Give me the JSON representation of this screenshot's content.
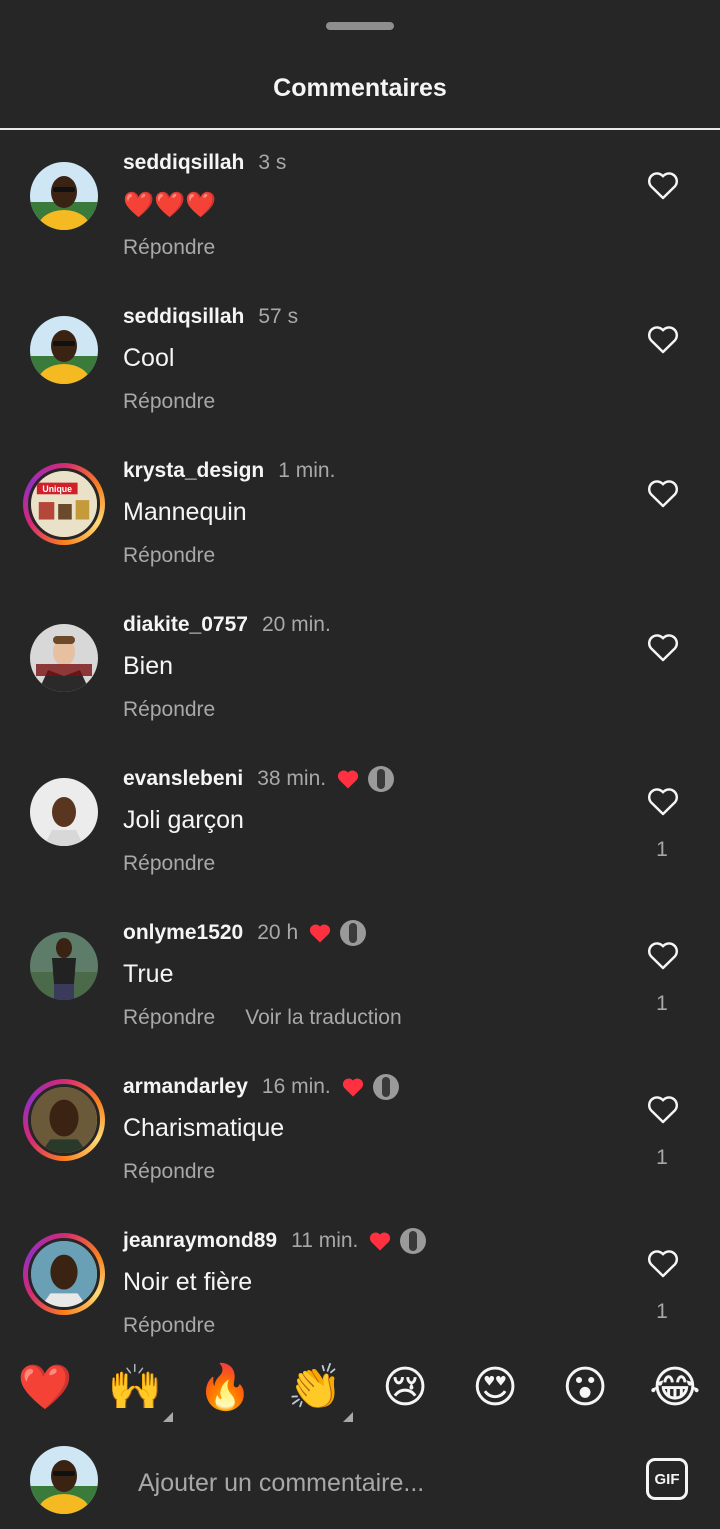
{
  "header": {
    "title": "Commentaires"
  },
  "reply_label": "Répondre",
  "comments": [
    {
      "username": "seddiqsillah",
      "time": "3 s",
      "text": "❤️❤️❤️",
      "likes": "",
      "author_liked": false,
      "actions": [
        "Répondre"
      ]
    },
    {
      "username": "seddiqsillah",
      "time": "57 s",
      "text": "Cool",
      "likes": "",
      "author_liked": false,
      "actions": [
        "Répondre"
      ]
    },
    {
      "username": "krysta_design",
      "time": "1 min.",
      "text": "Mannequin",
      "likes": "",
      "author_liked": false,
      "actions": [
        "Répondre"
      ]
    },
    {
      "username": "diakite_0757",
      "time": "20 min.",
      "text": "Bien",
      "likes": "",
      "author_liked": false,
      "actions": [
        "Répondre"
      ]
    },
    {
      "username": "evanslebeni",
      "time": "38 min.",
      "text": "Joli garçon",
      "likes": "1",
      "author_liked": true,
      "actions": [
        "Répondre"
      ]
    },
    {
      "username": "onlyme1520",
      "time": "20 h",
      "text": "True",
      "likes": "1",
      "author_liked": true,
      "actions": [
        "Répondre",
        "Voir la traduction"
      ]
    },
    {
      "username": "armandarley",
      "time": "16 min.",
      "text": "Charismatique",
      "likes": "1",
      "author_liked": true,
      "actions": [
        "Répondre"
      ]
    },
    {
      "username": "jeanraymond89",
      "time": "11 min.",
      "text": "Noir et fière",
      "likes": "1",
      "author_liked": true,
      "actions": [
        "Répondre"
      ]
    }
  ],
  "avatar_text": {
    "krysta_design": "Unique"
  },
  "emoji_bar": [
    {
      "icon": "red-heart-icon",
      "glyph": "❤️",
      "has_variants": false
    },
    {
      "icon": "raising-hands-icon",
      "glyph": "🙌",
      "has_variants": true
    },
    {
      "icon": "fire-icon",
      "glyph": "🔥",
      "has_variants": false
    },
    {
      "icon": "clapping-hands-icon",
      "glyph": "👏",
      "has_variants": true
    },
    {
      "icon": "crying-face-icon",
      "glyph": "😢",
      "has_variants": false
    },
    {
      "icon": "heart-eyes-icon",
      "glyph": "😍",
      "has_variants": false
    },
    {
      "icon": "surprised-face-icon",
      "glyph": "😮",
      "has_variants": false
    },
    {
      "icon": "tears-of-joy-icon",
      "glyph": "😂",
      "has_variants": false
    }
  ],
  "composer": {
    "placeholder": "Ajouter un commentaire...",
    "gif_label": "GIF"
  },
  "colors": {
    "background": "#262626",
    "text": "#f5f5f5",
    "secondary": "#a8a8a8",
    "like_red": "#ff3040"
  }
}
